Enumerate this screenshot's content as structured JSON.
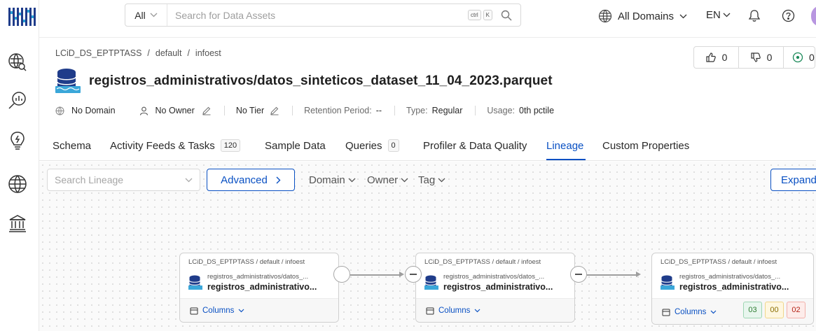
{
  "search": {
    "scope": "All",
    "placeholder": "Search for Data Assets",
    "kbd_ctrl": "ctrl",
    "kbd_k": "K"
  },
  "top": {
    "domains": "All Domains",
    "lang": "EN"
  },
  "breadcrumb": [
    "LCiD_DS_EPTPTASS",
    "/",
    "default",
    "/",
    "infoest"
  ],
  "title": "registros_administrativos/datos_sinteticos_dataset_11_04_2023.parquet",
  "votes": {
    "up": "0",
    "down": "0",
    "followers": "0"
  },
  "meta": {
    "domain": "No Domain",
    "owner": "No Owner",
    "tier": "No Tier",
    "retention_key": "Retention Period:",
    "retention_val": "--",
    "type_key": "Type:",
    "type_val": "Regular",
    "usage_key": "Usage:",
    "usage_val": "0th pctile"
  },
  "tabs": [
    {
      "label": "Schema"
    },
    {
      "label": "Activity Feeds & Tasks",
      "count": "120"
    },
    {
      "label": "Sample Data"
    },
    {
      "label": "Queries",
      "count": "0"
    },
    {
      "label": "Profiler & Data Quality"
    },
    {
      "label": "Lineage",
      "active": true
    },
    {
      "label": "Custom Properties"
    }
  ],
  "lineage_toolbar": {
    "search_placeholder": "Search Lineage",
    "advanced": "Advanced",
    "filters": [
      "Domain",
      "Owner",
      "Tag"
    ],
    "expand": "Expand"
  },
  "nodes": [
    {
      "path": "LCiD_DS_EPTPTASS / default / infoest",
      "sub": "registros_administrativos/datos_...",
      "name": "registros_administrativo...",
      "columns": "Columns"
    },
    {
      "path": "LCiD_DS_EPTPTASS / default / infoest",
      "sub": "registros_administrativos/datos_...",
      "name": "registros_administrativo...",
      "columns": "Columns"
    },
    {
      "path": "LCiD_DS_EPTPTASS / default / infoest",
      "sub": "registros_administrativos/datos_...",
      "name": "registros_administrativo...",
      "columns": "Columns",
      "dq": [
        {
          "value": "03",
          "color": "#2e7d32",
          "bg": "#e8f6ee",
          "border": "#9fd6b3"
        },
        {
          "value": "00",
          "color": "#8a6d00",
          "bg": "#fff7e0",
          "border": "#f0d68a"
        },
        {
          "value": "02",
          "color": "#b42318",
          "bg": "#fdecea",
          "border": "#f2b1ab"
        }
      ]
    }
  ],
  "colors": {
    "primary": "#0950c3"
  }
}
